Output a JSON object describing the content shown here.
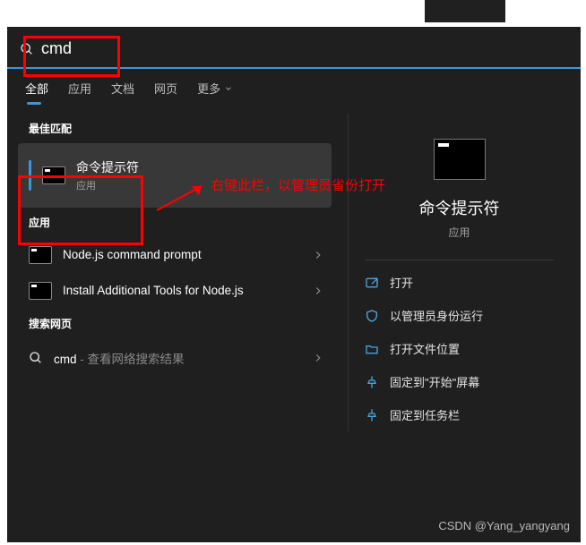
{
  "search": {
    "query": "cmd"
  },
  "tabs": {
    "all": "全部",
    "apps": "应用",
    "docs": "文档",
    "web": "网页",
    "more": "更多"
  },
  "sections": {
    "best_match": "最佳匹配",
    "apps": "应用",
    "search_web": "搜索网页"
  },
  "best": {
    "title": "命令提示符",
    "sub": "应用"
  },
  "apps": [
    {
      "title": "Node.js command prompt"
    },
    {
      "title": "Install Additional Tools for Node.js"
    }
  ],
  "web": {
    "term": "cmd",
    "hint": " - 查看网络搜索结果"
  },
  "preview": {
    "title": "命令提示符",
    "sub": "应用"
  },
  "actions": {
    "open": "打开",
    "run_admin": "以管理员身份运行",
    "open_location": "打开文件位置",
    "pin_start": "固定到\"开始\"屏幕",
    "pin_taskbar": "固定到任务栏"
  },
  "annotation": "右键此栏，以管理员省份打开",
  "watermark": "CSDN @Yang_yangyang"
}
